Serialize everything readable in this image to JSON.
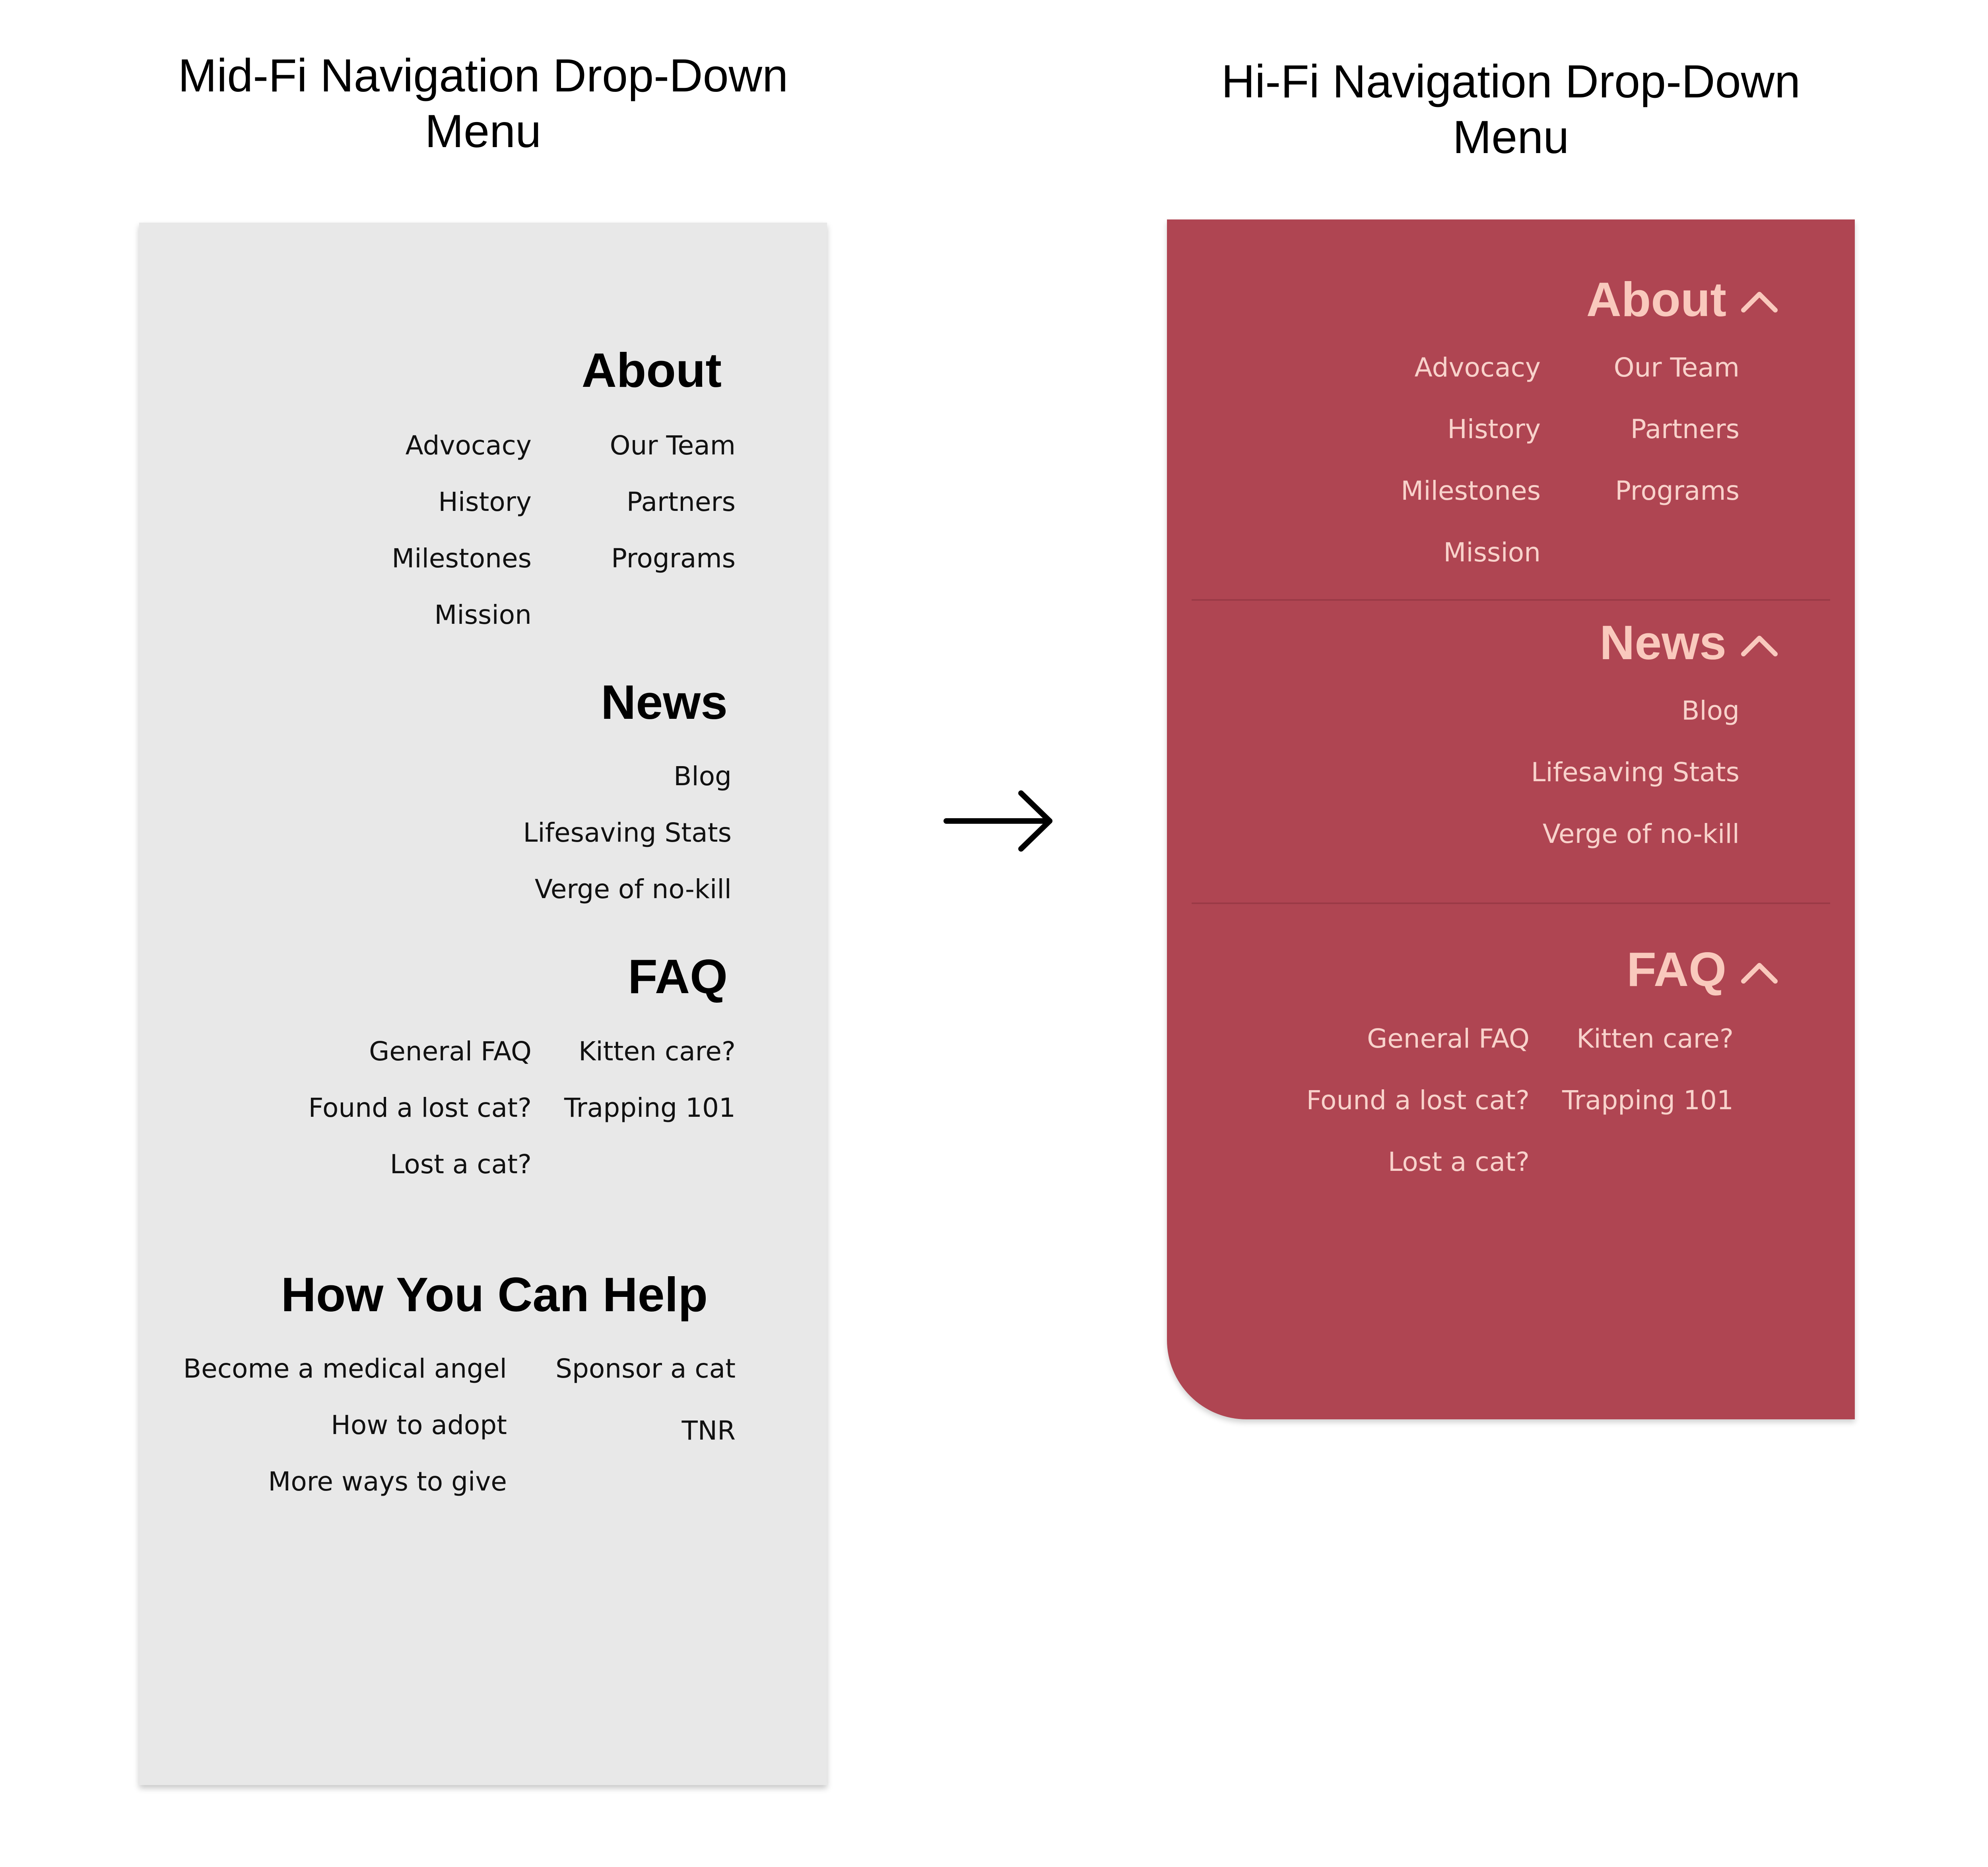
{
  "headings": {
    "midfi": [
      "Mid-Fi Navigation Drop-Down",
      "Menu"
    ],
    "hifi": [
      "Hi-Fi Navigation Drop-Down",
      "Menu"
    ]
  },
  "midfi": {
    "about": {
      "title": "About",
      "left": [
        "Advocacy",
        "History",
        "Milestones",
        "Mission"
      ],
      "right": [
        "Our Team",
        "Partners",
        "Programs"
      ]
    },
    "news": {
      "title": "News",
      "items": [
        "Blog",
        "Lifesaving Stats",
        "Verge of no-kill"
      ]
    },
    "faq": {
      "title": "FAQ",
      "left": [
        "General FAQ",
        "Found a lost cat?",
        "Lost a cat?"
      ],
      "right": [
        "Kitten care?",
        "Trapping 101"
      ]
    },
    "help": {
      "title": "How You Can Help",
      "left": [
        "Become a medical angel",
        "How to adopt",
        "More ways to give"
      ],
      "right": [
        "Sponsor a cat",
        "TNR"
      ]
    }
  },
  "hifi": {
    "about": {
      "title": "About",
      "left": [
        "Advocacy",
        "History",
        "Milestones",
        "Mission"
      ],
      "right": [
        "Our Team",
        "Partners",
        "Programs"
      ]
    },
    "news": {
      "title": "News",
      "items": [
        "Blog",
        "Lifesaving Stats",
        "Verge of no-kill"
      ]
    },
    "faq": {
      "title": "FAQ",
      "left": [
        "General FAQ",
        "Found a lost cat?",
        "Lost a cat?"
      ],
      "right": [
        "Kitten care?",
        "Trapping 101"
      ]
    }
  },
  "icons": {
    "arrow": "right-arrow-icon",
    "collapse": "chevron-up-icon"
  },
  "colors": {
    "midfi_bg": "#e8e8e8",
    "hifi_bg": "#af4552",
    "hifi_heading": "#f9c9bd",
    "hifi_text": "#f8d2cb"
  }
}
